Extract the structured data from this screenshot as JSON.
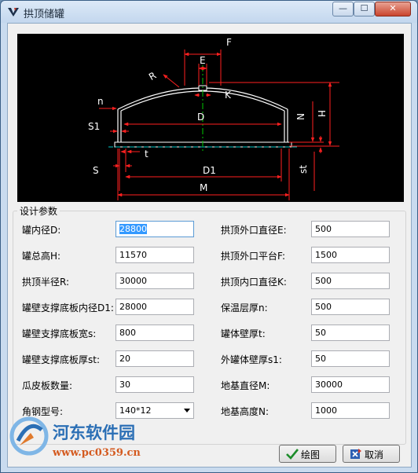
{
  "window": {
    "title": "拱顶储罐",
    "minimize_glyph": "—",
    "maximize_glyph": "☐",
    "close_glyph": "✕"
  },
  "drawing": {
    "labels": {
      "F": "F",
      "E": "E",
      "R": "R",
      "K": "K",
      "n": "n",
      "D": "D",
      "S1": "S1",
      "N": "N",
      "H": "H",
      "S": "S",
      "t": "t",
      "D1": "D1",
      "st": "st",
      "M": "M"
    },
    "colors": {
      "background": "#000000",
      "outline": "#ffffff",
      "dimension": "#ff2020",
      "centerline": "#00c8c8",
      "axis": "#00c800"
    }
  },
  "params": {
    "group_title": "设计参数",
    "left": [
      {
        "label": "罐内径D:",
        "value": "28800"
      },
      {
        "label": "罐总高H:",
        "value": "11570"
      },
      {
        "label": "拱顶半径R:",
        "value": "30000"
      },
      {
        "label": "罐壁支撑底板内径D1:",
        "value": "28000"
      },
      {
        "label": "罐壁支撑底板宽s:",
        "value": "800"
      },
      {
        "label": "罐壁支撑底板厚st:",
        "value": "20"
      },
      {
        "label": "瓜皮板数量:",
        "value": "30"
      },
      {
        "label": "角钢型号:",
        "value": "140*12"
      }
    ],
    "right": [
      {
        "label": "拱顶外口直径E:",
        "value": "500"
      },
      {
        "label": "拱顶外口平台F:",
        "value": "1500"
      },
      {
        "label": "拱顶内口直径K:",
        "value": "500"
      },
      {
        "label": "保温层厚n:",
        "value": "500"
      },
      {
        "label": "罐体壁厚t:",
        "value": "50"
      },
      {
        "label": "外罐体壁厚s1:",
        "value": "50"
      },
      {
        "label": "地基直径M:",
        "value": "30000"
      },
      {
        "label": "地基高度N:",
        "value": "1000"
      }
    ]
  },
  "buttons": {
    "draw": "绘图",
    "cancel": "取消"
  },
  "watermark": {
    "name": "河东软件园",
    "url": "www.pc0359.cn"
  }
}
